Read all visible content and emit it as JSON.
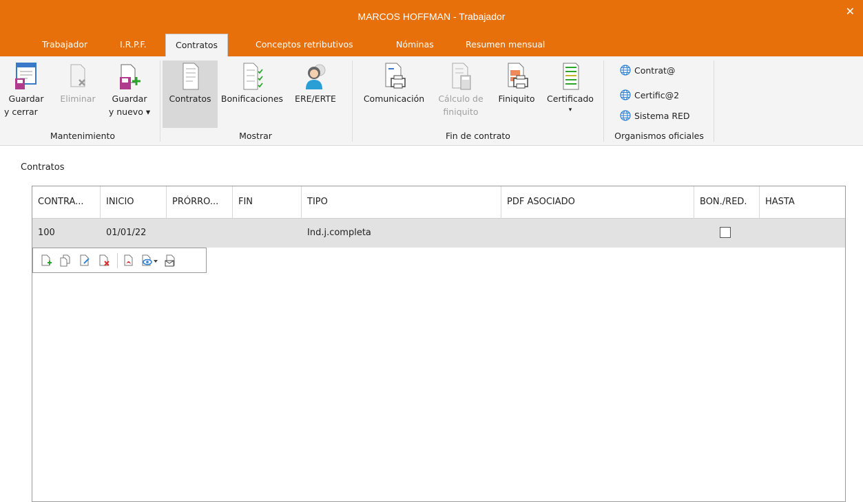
{
  "window": {
    "title": "MARCOS HOFFMAN - Trabajador",
    "close_label": "✕"
  },
  "tabs": [
    {
      "label": "Trabajador"
    },
    {
      "label": "I.R.P.F."
    },
    {
      "label": "Contratos"
    },
    {
      "label": "Conceptos retributivos"
    },
    {
      "label": "Nóminas"
    },
    {
      "label": "Resumen mensual"
    }
  ],
  "ribbon": {
    "mantenimiento": {
      "label": "Mantenimiento",
      "guardar_cerrar": [
        "Guardar",
        "y cerrar"
      ],
      "eliminar": "Eliminar",
      "guardar_nuevo": [
        "Guardar",
        "y nuevo ▾"
      ]
    },
    "mostrar": {
      "label": "Mostrar",
      "contratos": "Contratos",
      "bonificaciones": "Bonificaciones",
      "ere_erte": "ERE/ERTE"
    },
    "fin_contrato": {
      "label": "Fin de contrato",
      "comunicacion": "Comunicación",
      "calculo_finiquito": [
        "Cálculo de",
        "finiquito"
      ],
      "finiquito": "Finiquito",
      "certificado": "Certificado",
      "certificado_arrow": "▾"
    },
    "organismos": {
      "label": "Organismos oficiales",
      "contrata": "Contrat@",
      "certifica": "Certific@2",
      "sistema_red": "Sistema RED"
    }
  },
  "content": {
    "title": "Contratos",
    "columns": [
      "CONTRA...",
      "INICIO",
      "PRÓRRO...",
      "FIN",
      "TIPO",
      "PDF ASOCIADO",
      "BON./RED.",
      "HASTA"
    ],
    "rows": [
      {
        "contrato": "100",
        "inicio": "01/01/22",
        "prorroga": "",
        "fin": "",
        "tipo": "Ind.j.completa",
        "pdf": "",
        "bonred": false,
        "hasta": ""
      }
    ]
  },
  "colors": {
    "accent": "#E8700B",
    "ribbon_bg": "#f4f4f4",
    "selected_row": "#e2e2e2"
  }
}
